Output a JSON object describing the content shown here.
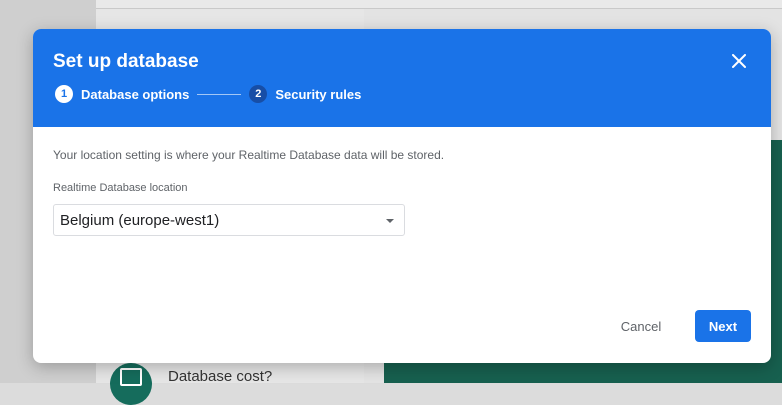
{
  "background": {
    "card_text": "Database cost?",
    "card_icon": "card-icon"
  },
  "dialog": {
    "title": "Set up database",
    "close_icon": "close-icon",
    "steps": [
      {
        "number": "1",
        "label": "Database options",
        "state": "active"
      },
      {
        "number": "2",
        "label": "Security rules",
        "state": "inactive"
      }
    ],
    "description": "Your location setting is where your Realtime Database data will be stored.",
    "location_field": {
      "label": "Realtime Database location",
      "value": "Belgium (europe-west1)"
    },
    "buttons": {
      "cancel": "Cancel",
      "next": "Next"
    }
  },
  "colors": {
    "primary": "#1a73e8",
    "step_inactive": "#174ea6",
    "background_teal": "#17604f"
  }
}
